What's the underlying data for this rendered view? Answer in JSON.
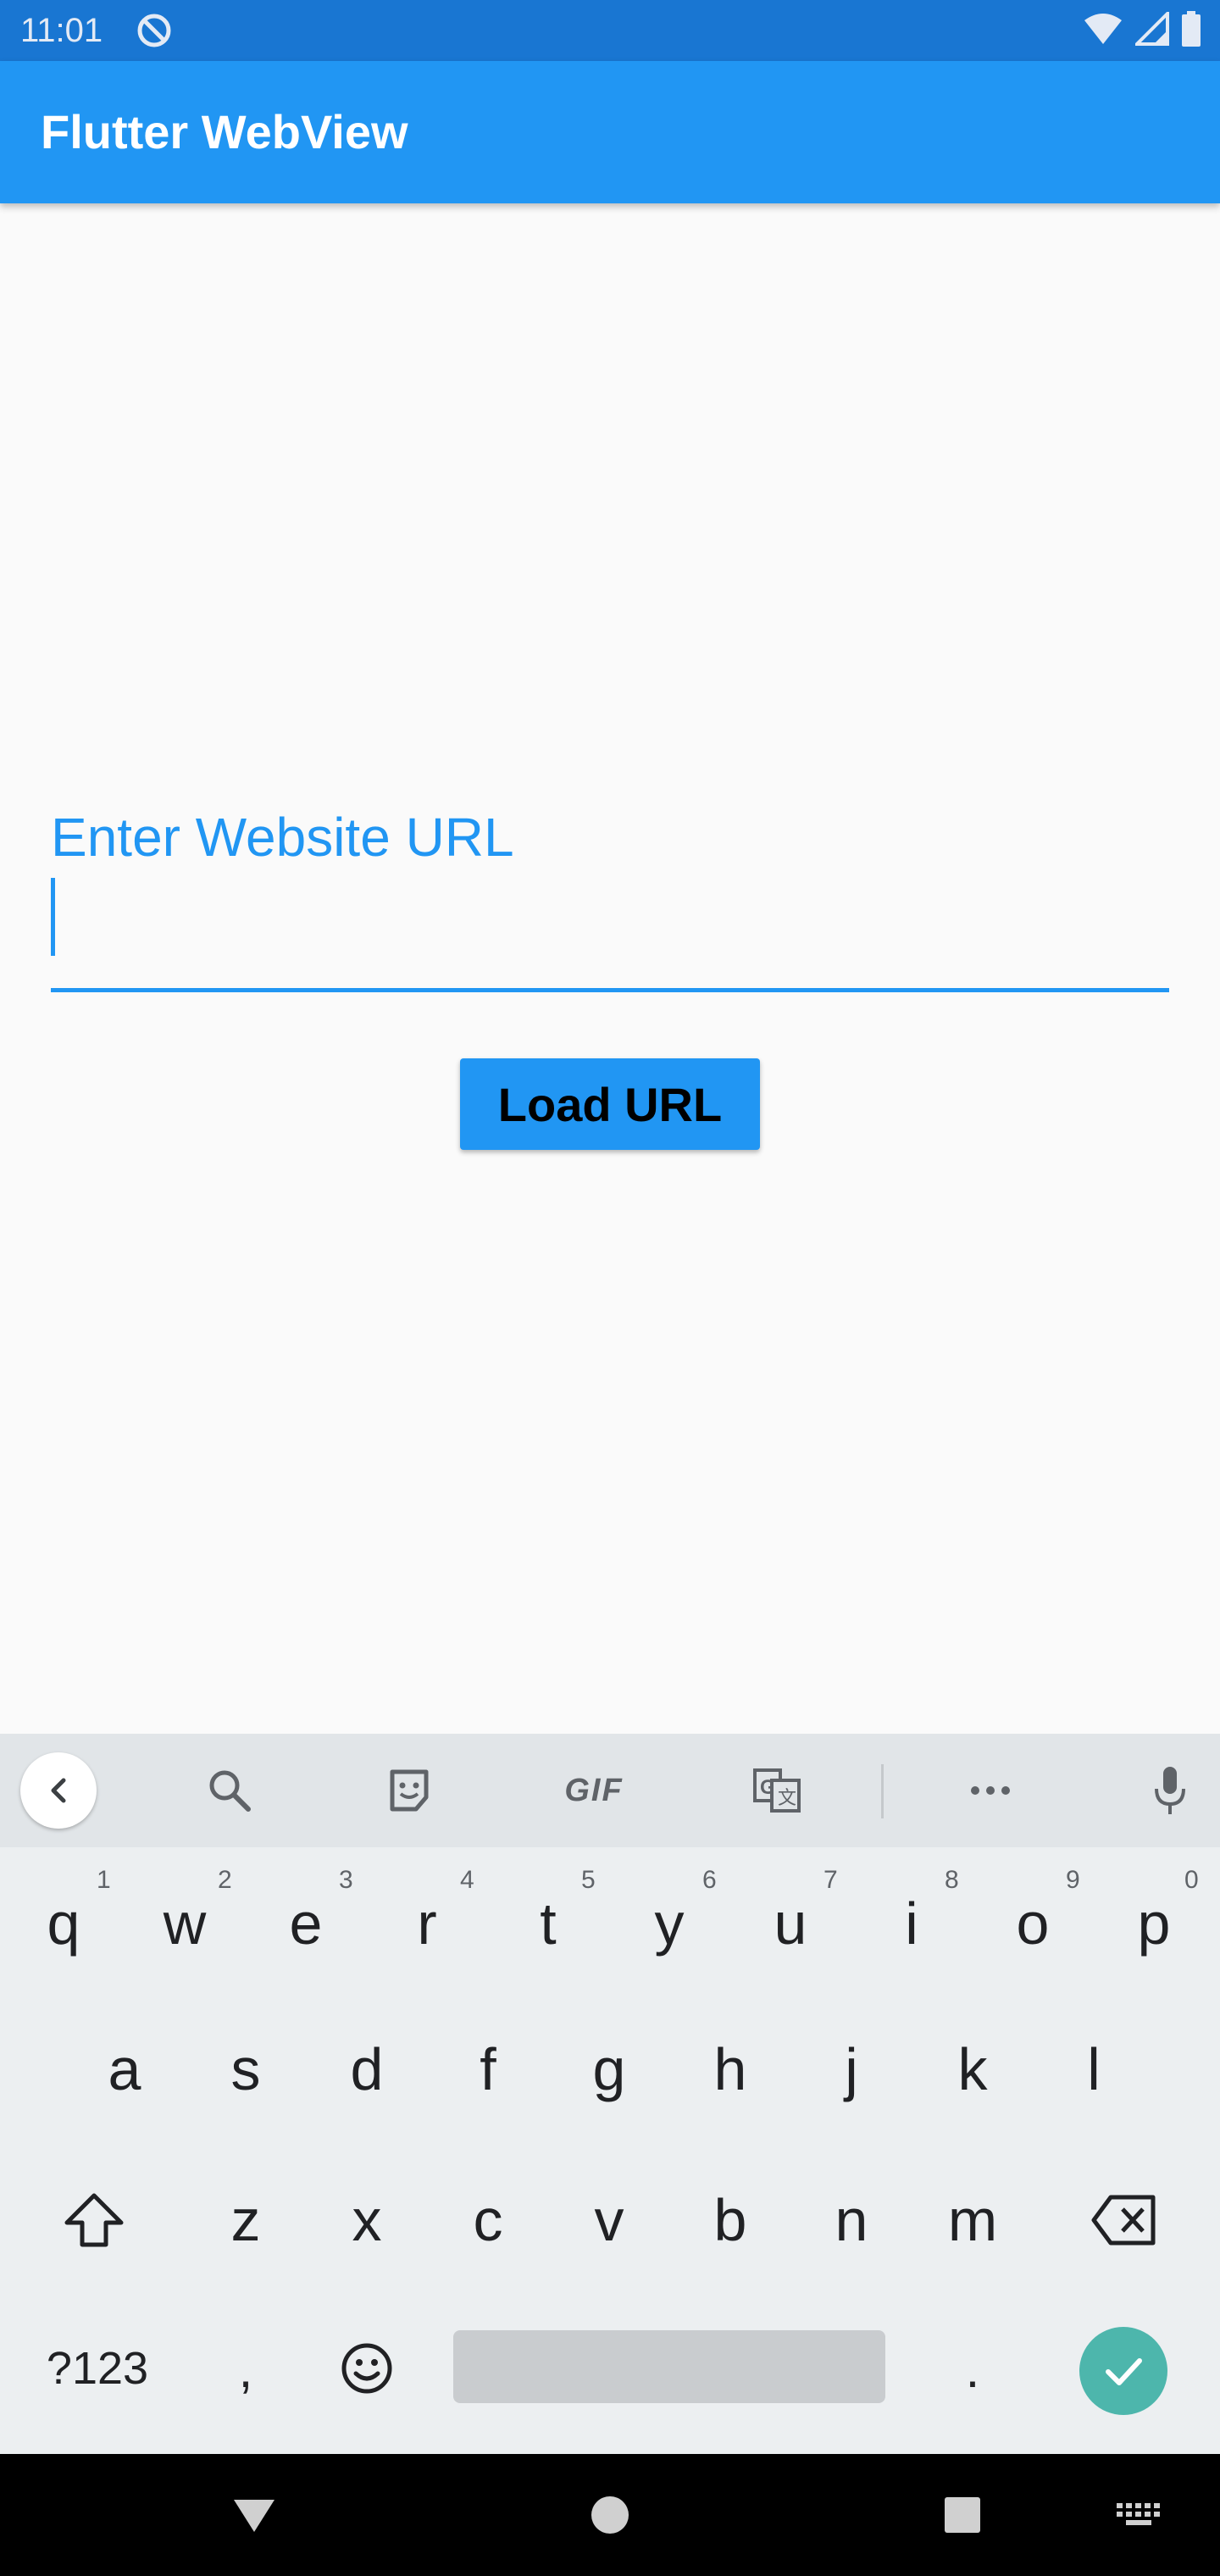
{
  "status_bar": {
    "time": "11:01",
    "icons": [
      "do-not-disturb-icon",
      "wifi-icon",
      "signal-icon",
      "battery-icon"
    ]
  },
  "app_bar": {
    "title": "Flutter WebView",
    "color": "#2196f3"
  },
  "form": {
    "label": "Enter Website URL",
    "value": "",
    "button_label": "Load URL"
  },
  "keyboard": {
    "toolbar_icons": [
      "back-chevron-icon",
      "search-icon",
      "sticker-icon",
      "gif-icon",
      "translate-icon",
      "more-icon",
      "microphone-icon"
    ],
    "gif_label": "GIF",
    "row1": [
      {
        "key": "q",
        "num": "1"
      },
      {
        "key": "w",
        "num": "2"
      },
      {
        "key": "e",
        "num": "3"
      },
      {
        "key": "r",
        "num": "4"
      },
      {
        "key": "t",
        "num": "5"
      },
      {
        "key": "y",
        "num": "6"
      },
      {
        "key": "u",
        "num": "7"
      },
      {
        "key": "i",
        "num": "8"
      },
      {
        "key": "o",
        "num": "9"
      },
      {
        "key": "p",
        "num": "0"
      }
    ],
    "row2": [
      "a",
      "s",
      "d",
      "f",
      "g",
      "h",
      "j",
      "k",
      "l"
    ],
    "row3": [
      "z",
      "x",
      "c",
      "v",
      "b",
      "n",
      "m"
    ],
    "symbols_label": "?123",
    "comma": ",",
    "period": ".",
    "accent_color": "#4db6ac"
  },
  "nav_bar": {
    "icons": [
      "back-triangle-icon",
      "home-circle-icon",
      "recents-square-icon",
      "keyboard-switch-icon"
    ]
  }
}
